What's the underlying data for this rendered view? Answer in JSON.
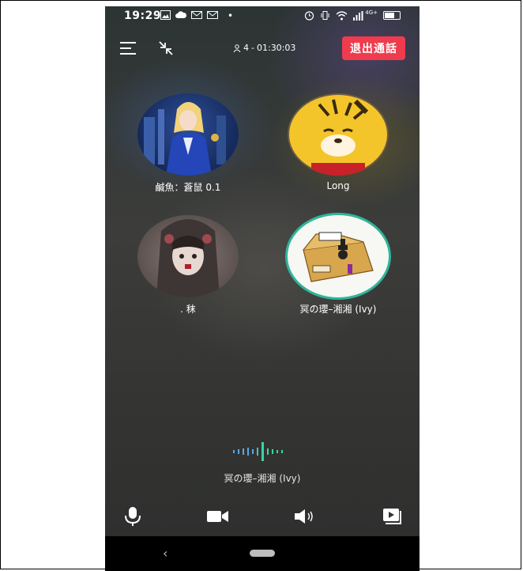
{
  "status_bar": {
    "time": "19:29",
    "network": "4G+"
  },
  "header": {
    "participants": "4",
    "duration": "01:30:03",
    "exit_label": "退出通話"
  },
  "users": [
    {
      "name": "鹹魚：蒼鼠 0.1",
      "avatar": "anime-girl-avatar",
      "speaking": false
    },
    {
      "name": "Long",
      "avatar": "tiger-avatar",
      "speaking": false
    },
    {
      "name": ". 秣",
      "avatar": "doll-photo-avatar",
      "speaking": false
    },
    {
      "name": "冥の瓔–湘湘 (Ivy)",
      "avatar": "cardboard-box-avatar",
      "speaking": true
    }
  ],
  "active_speaker": {
    "name": "冥の瓔–湘湘 (Ivy)"
  },
  "controls": [
    "microphone-icon",
    "camera-icon",
    "speaker-icon",
    "screen-share-icon"
  ],
  "colors": {
    "exit": "#ef3b4e",
    "speaking_ring": "#2fb59a",
    "wave_blue": "#5aa8e6",
    "wave_green": "#38d6a0"
  }
}
